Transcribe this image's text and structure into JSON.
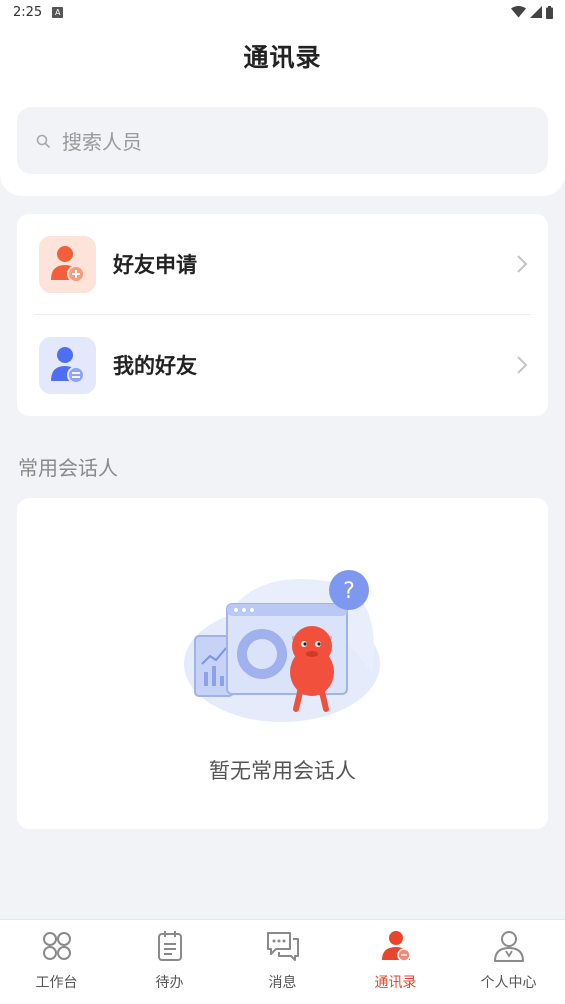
{
  "status_bar": {
    "time": "2:25",
    "notification_glyph": "A"
  },
  "header": {
    "title": "通讯录"
  },
  "search": {
    "placeholder": "搜索人员"
  },
  "friend_menu": [
    {
      "label": "好友申请",
      "icon": "add-user-icon",
      "icon_bg": "#fde3da",
      "icon_color": "#f2603b"
    },
    {
      "label": "我的好友",
      "icon": "friend-list-icon",
      "icon_bg": "#e3e8fd",
      "icon_color": "#4f6ef2"
    }
  ],
  "frequent_contacts": {
    "section_title": "常用会话人",
    "empty_text": "暂无常用会话人"
  },
  "tab_bar": {
    "active_index": 3,
    "active_color": "#e8452c",
    "items": [
      {
        "label": "工作台",
        "icon": "workbench-icon"
      },
      {
        "label": "待办",
        "icon": "todo-icon"
      },
      {
        "label": "消息",
        "icon": "message-icon"
      },
      {
        "label": "通讯录",
        "icon": "contacts-icon"
      },
      {
        "label": "个人中心",
        "icon": "profile-icon"
      }
    ]
  }
}
